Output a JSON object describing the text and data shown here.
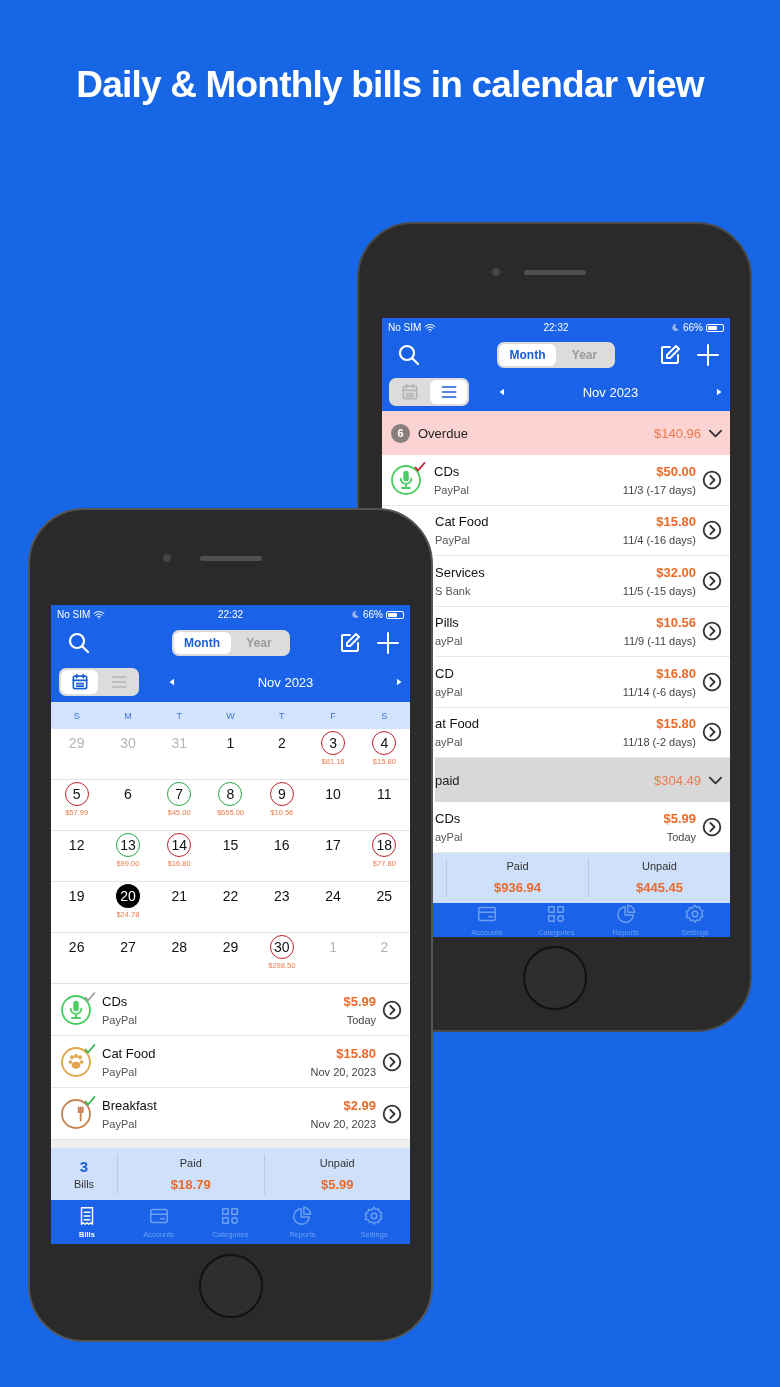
{
  "headline": "Daily & Monthly bills in calendar view",
  "back_phone": {
    "status_bar": {
      "carrier": "No SIM",
      "time": "22:32",
      "battery": "66%"
    },
    "period_toggle": [
      {
        "label": "Month",
        "selected": true
      },
      {
        "label": "Year",
        "selected": false
      }
    ],
    "view_toggle": [
      {
        "kind": "calendar",
        "selected": false
      },
      {
        "kind": "list",
        "selected": true
      }
    ],
    "period": "Nov 2023",
    "groups": [
      {
        "kind": "overdue",
        "count": "6",
        "title": "Overdue",
        "total": "$140.96",
        "expanded": true,
        "bills": [
          {
            "name": "CDs",
            "account": "PayPal",
            "amount": "$50.00",
            "due": "11/3 (-17 days)",
            "kind": "audio",
            "color": "#b51f2b"
          },
          {
            "name": "Cat Food",
            "account": "PayPal",
            "amount": "$15.80",
            "due": "11/4 (-16 days)"
          },
          {
            "name": "Services",
            "account": "S Bank",
            "amount": "$32.00",
            "due": "11/5 (-15 days)"
          },
          {
            "name": "Pills",
            "account": "ayPal",
            "amount": "$10.56",
            "due": "11/9 (-11 days)"
          },
          {
            "name": "CD",
            "account": "ayPal",
            "amount": "$16.80",
            "due": "11/14 (-6 days)"
          },
          {
            "name": "at Food",
            "account": "ayPal",
            "amount": "$15.80",
            "due": "11/18 (-2 days)"
          }
        ]
      },
      {
        "kind": "unpaid",
        "title": "paid",
        "total": "$304.49",
        "expanded": true,
        "bills": [
          {
            "name": "CDs",
            "account": "ayPal",
            "amount": "$5.99",
            "due": "Today"
          }
        ]
      }
    ],
    "summary": [
      {
        "label": "Paid",
        "value": "$936.94"
      },
      {
        "label": "Unpaid",
        "value": "$445.45"
      }
    ],
    "tabs": [
      {
        "label": "Accounts",
        "kind": "card",
        "selected": false
      },
      {
        "label": "Categories",
        "kind": "grid",
        "selected": false
      },
      {
        "label": "Reports",
        "kind": "pie",
        "selected": false
      },
      {
        "label": "Settings",
        "kind": "gear",
        "selected": false
      }
    ]
  },
  "front_phone": {
    "status_bar": {
      "carrier": "No SIM",
      "time": "22:32",
      "battery": "66%"
    },
    "period_toggle": [
      {
        "label": "Month",
        "selected": true
      },
      {
        "label": "Year",
        "selected": false
      }
    ],
    "view_toggle": [
      {
        "kind": "calendar",
        "selected": true
      },
      {
        "kind": "list",
        "selected": false
      }
    ],
    "period": "Nov 2023",
    "weekdays": [
      "S",
      "M",
      "T",
      "W",
      "T",
      "F",
      "S"
    ],
    "days": [
      {
        "day": "29",
        "kind": "other"
      },
      {
        "day": "30",
        "kind": "other"
      },
      {
        "day": "31",
        "kind": "other"
      },
      {
        "day": "1",
        "kind": "plain"
      },
      {
        "day": "2",
        "kind": "plain"
      },
      {
        "day": "3",
        "kind": "overdue",
        "amount": "$81.16"
      },
      {
        "day": "4",
        "kind": "overdue",
        "amount": "$15.80"
      },
      {
        "day": "5",
        "kind": "overdue",
        "amount": "$57.99"
      },
      {
        "day": "6",
        "kind": "plain"
      },
      {
        "day": "7",
        "kind": "paid",
        "amount": "$45.00"
      },
      {
        "day": "8",
        "kind": "paid",
        "amount": "$655.00"
      },
      {
        "day": "9",
        "kind": "overdue",
        "amount": "$10.56"
      },
      {
        "day": "10",
        "kind": "plain"
      },
      {
        "day": "11",
        "kind": "plain"
      },
      {
        "day": "12",
        "kind": "plain"
      },
      {
        "day": "13",
        "kind": "paid",
        "amount": "$99.00"
      },
      {
        "day": "14",
        "kind": "overdue",
        "amount": "$16.80"
      },
      {
        "day": "15",
        "kind": "plain"
      },
      {
        "day": "16",
        "kind": "plain"
      },
      {
        "day": "17",
        "kind": "plain"
      },
      {
        "day": "18",
        "kind": "overdue",
        "amount": "$77.80"
      },
      {
        "day": "19",
        "kind": "plain"
      },
      {
        "day": "20",
        "kind": "today",
        "amount": "$24.78"
      },
      {
        "day": "21",
        "kind": "plain"
      },
      {
        "day": "22",
        "kind": "plain"
      },
      {
        "day": "23",
        "kind": "plain"
      },
      {
        "day": "24",
        "kind": "plain"
      },
      {
        "day": "25",
        "kind": "plain"
      },
      {
        "day": "26",
        "kind": "plain"
      },
      {
        "day": "27",
        "kind": "plain"
      },
      {
        "day": "28",
        "kind": "plain"
      },
      {
        "day": "29",
        "kind": "plain"
      },
      {
        "day": "30",
        "kind": "overdue",
        "amount": "$298.50"
      },
      {
        "day": "1",
        "kind": "other"
      },
      {
        "day": "2",
        "kind": "other"
      }
    ],
    "bills": [
      {
        "name": "CDs",
        "account": "PayPal",
        "amount": "$5.99",
        "due": "Today",
        "kind": "audio",
        "color": "#9a9a9a"
      },
      {
        "name": "Cat Food",
        "account": "PayPal",
        "amount": "$15.80",
        "due": "Nov 20, 2023",
        "kind": "pet",
        "color": "#2fb34a"
      },
      {
        "name": "Breakfast",
        "account": "PayPal",
        "amount": "$2.99",
        "due": "Nov 20, 2023",
        "kind": "food",
        "color": "#2fb34a"
      }
    ],
    "summary": {
      "count": "3",
      "count_label": "Bills",
      "columns": [
        {
          "label": "Paid",
          "value": "$18.79"
        },
        {
          "label": "Unpaid",
          "value": "$5.99"
        }
      ]
    },
    "tabs": [
      {
        "label": "Bills",
        "kind": "receipt",
        "selected": true
      },
      {
        "label": "Accounts",
        "kind": "card",
        "selected": false
      },
      {
        "label": "Categories",
        "kind": "grid",
        "selected": false
      },
      {
        "label": "Reports",
        "kind": "pie",
        "selected": false
      },
      {
        "label": "Settings",
        "kind": "gear",
        "selected": false
      }
    ]
  }
}
